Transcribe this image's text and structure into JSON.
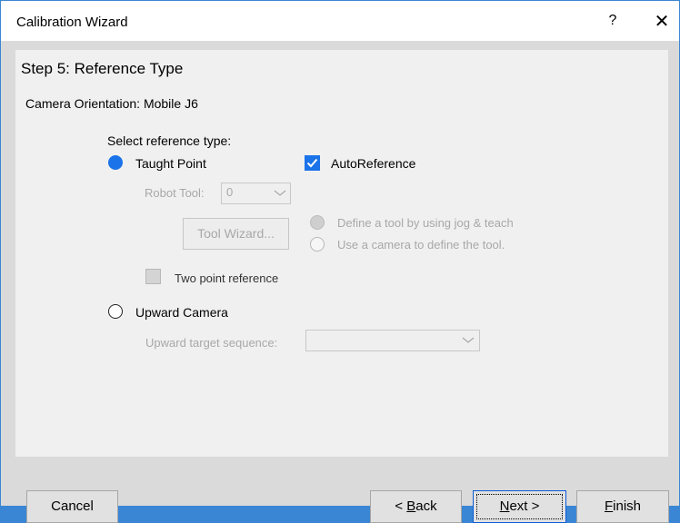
{
  "window": {
    "title": "Calibration Wizard",
    "help_label": "?",
    "close_label": "✕"
  },
  "step": {
    "title": "Step 5: Reference Type",
    "orientation": "Camera Orientation: Mobile J6"
  },
  "reference": {
    "prompt": "Select reference type:",
    "taught_point": {
      "label": "Taught Point",
      "selected": true
    },
    "auto_reference": {
      "label": "AutoReference",
      "checked": true
    },
    "robot_tool": {
      "label": "Robot Tool:",
      "value": "0"
    },
    "tool_wizard_label": "Tool Wizard...",
    "define_tool_jog": {
      "label": "Define a tool by using jog & teach",
      "selected": true
    },
    "use_camera_tool": {
      "label": "Use a camera to define the tool.",
      "selected": false
    },
    "two_point": {
      "label": "Two point reference",
      "checked": false
    },
    "upward_camera": {
      "label": "Upward Camera",
      "selected": false
    },
    "upward_sequence": {
      "label": "Upward target sequence:",
      "value": ""
    }
  },
  "buttons": {
    "cancel": "Cancel",
    "back_prefix": "< ",
    "back_mnemonic": "B",
    "back_rest": "ack",
    "next_mnemonic": "N",
    "next_rest": "ext >",
    "finish_mnemonic": "F",
    "finish_rest": "inish"
  },
  "colors": {
    "accent": "#1a73e8",
    "window_border": "#3b86d4",
    "disabled_text": "#a8a8a8"
  }
}
